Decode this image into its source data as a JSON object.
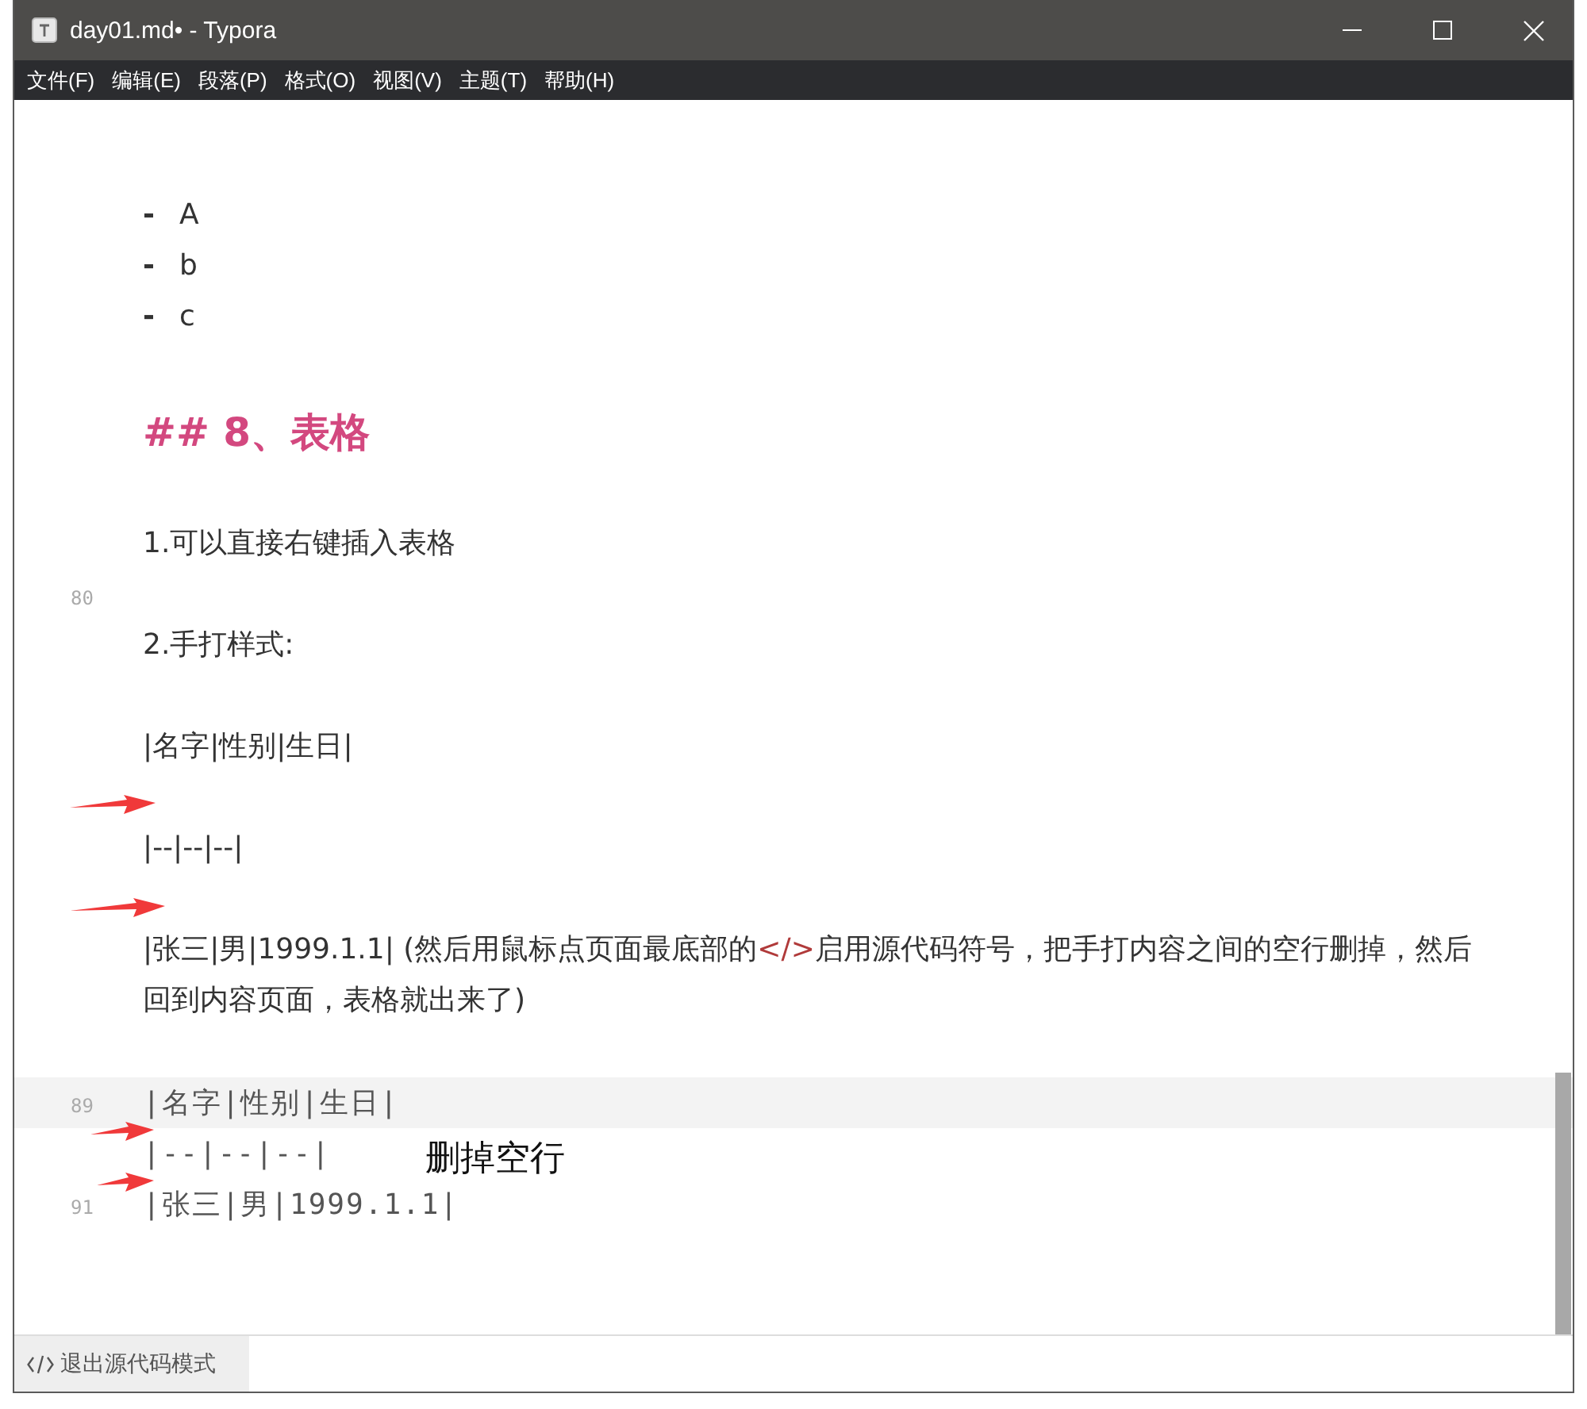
{
  "window": {
    "title": "day01.md• - Typora"
  },
  "menu": [
    "文件(F)",
    "编辑(E)",
    "段落(P)",
    "格式(O)",
    "视图(V)",
    "主题(T)",
    "帮助(H)"
  ],
  "editor": {
    "lines": [
      {
        "kind": "list_item",
        "marker": "-",
        "text": "A"
      },
      {
        "kind": "list_item",
        "marker": "-",
        "text": "b"
      },
      {
        "kind": "list_item",
        "marker": "-",
        "text": "c"
      },
      {
        "kind": "blank"
      },
      {
        "kind": "heading",
        "text": "## 8、表格"
      },
      {
        "kind": "blank"
      },
      {
        "kind": "paragraph",
        "segments": [
          {
            "text": "1.可以直接右键插入表格"
          }
        ]
      },
      {
        "kind": "blank",
        "line_number": "80"
      },
      {
        "kind": "paragraph",
        "segments": [
          {
            "text": "2.手打样式:"
          }
        ]
      },
      {
        "kind": "blank"
      },
      {
        "kind": "paragraph",
        "segments": [
          {
            "text": "|名字|性别|生日|"
          }
        ]
      },
      {
        "kind": "blank"
      },
      {
        "kind": "paragraph",
        "segments": [
          {
            "text": "|--|--|--|"
          }
        ]
      },
      {
        "kind": "blank"
      },
      {
        "kind": "paragraph",
        "segments": [
          {
            "text": "|张三|男|1999.1.1|  (然后用鼠标点页面最底部的"
          },
          {
            "text": "</>",
            "kind": "code"
          },
          {
            "text": "启用源代码符号，把手打内容之间的空行删掉，然后回到内容页面，表格就出来了)"
          }
        ]
      },
      {
        "kind": "blank"
      },
      {
        "kind": "source",
        "line_number": "89",
        "text": "|名字|性别|生日|",
        "highlighted": true
      },
      {
        "kind": "source",
        "text": "|--|--|--|",
        "highlighted": false
      },
      {
        "kind": "source",
        "line_number": "91",
        "text": "|张三|男|1999.1.1|",
        "highlighted": false
      }
    ]
  },
  "annotation": {
    "note": "删掉空行"
  },
  "status_bar": {
    "button": "退出源代码模式"
  }
}
